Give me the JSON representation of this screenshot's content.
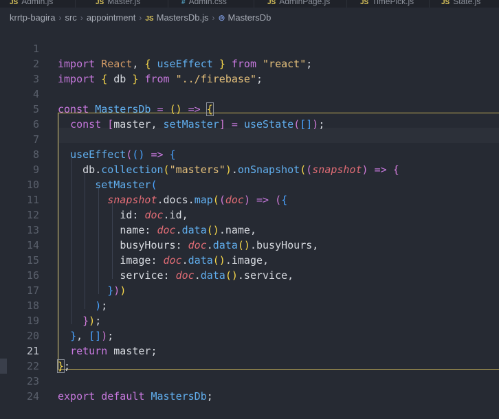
{
  "tabs": [
    {
      "label": "Admin.js",
      "icon": "JS"
    },
    {
      "label": "Master.js",
      "icon": "JS"
    },
    {
      "label": "Admin.css",
      "icon": "#"
    },
    {
      "label": "AdminPage.js",
      "icon": "JS"
    },
    {
      "label": "TimePick.js",
      "icon": "JS"
    },
    {
      "label": "State.js",
      "icon": "JS"
    }
  ],
  "breadcrumb": {
    "project": "krrtp-bagira",
    "folder1": "src",
    "folder2": "appointment",
    "file_icon": "JS",
    "file": "MastersDb.js",
    "symbol_icon": "symbol-icon",
    "symbol": "MastersDb"
  },
  "editor": {
    "active_line": 21,
    "line_numbers": [
      "1",
      "2",
      "3",
      "4",
      "5",
      "6",
      "7",
      "8",
      "9",
      "10",
      "11",
      "12",
      "13",
      "14",
      "15",
      "16",
      "17",
      "18",
      "19",
      "20",
      "21",
      "22",
      "23",
      "24"
    ],
    "lines": [
      "import React, { useEffect } from \"react\";",
      "import { db } from \"../firebase\";",
      "",
      "const MastersDb = () => {",
      "  const [master, setMaster] = useState([]);",
      "",
      "  useEffect(() => {",
      "    db.collection(\"masters\").onSnapshot((snapshot) => {",
      "      setMaster(",
      "        snapshot.docs.map((doc) => ({",
      "          id: doc.id,",
      "          name: doc.data().name,",
      "          busyHours: doc.data().busyHours,",
      "          image: doc.data().image,",
      "          service: doc.data().service,",
      "        }))",
      "      );",
      "    });",
      "  }, []);",
      "  return master;",
      "};",
      "",
      "export default MastersDb;",
      ""
    ]
  },
  "colors": {
    "background": "#262a33",
    "keyword": "#c678dd",
    "function": "#61afef",
    "string": "#e5c07b",
    "parameter": "#e06c75",
    "scope_border": "#c9b45a"
  }
}
